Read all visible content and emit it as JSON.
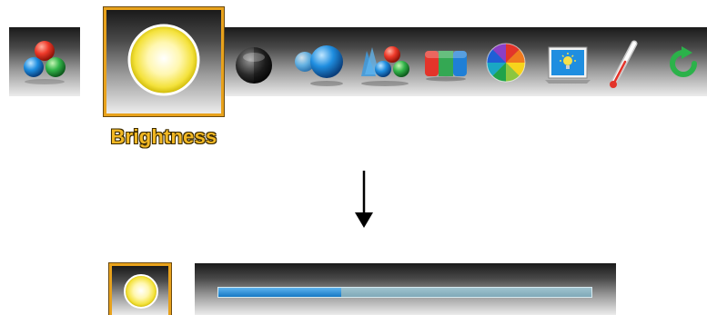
{
  "menu": {
    "selected_label": "Brightness",
    "items": [
      {
        "icon": "color-category-icon"
      },
      {
        "icon": "brightness-icon",
        "selected": true
      },
      {
        "icon": "contrast-icon"
      },
      {
        "icon": "sharpness-icon"
      },
      {
        "icon": "color-balance-icon"
      },
      {
        "icon": "color-bars-icon"
      },
      {
        "icon": "color-wheel-icon"
      },
      {
        "icon": "display-brightness-icon"
      },
      {
        "icon": "color-temperature-icon"
      },
      {
        "icon": "reset-icon"
      }
    ]
  },
  "slider": {
    "icon": "brightness-icon",
    "level": 0.33
  },
  "colors": {
    "selection_border": "#e8a21c",
    "label_text": "#f2b824",
    "slider_fill": "#1578c4"
  }
}
